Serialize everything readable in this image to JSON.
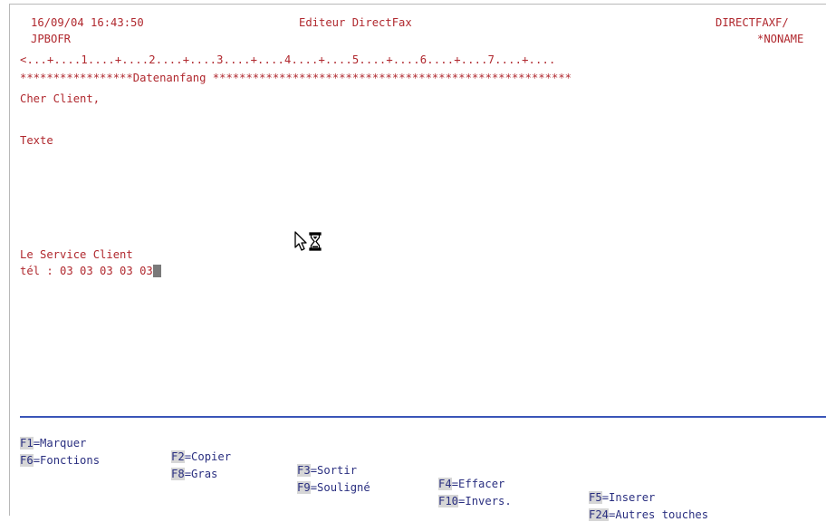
{
  "header": {
    "datetime": "16/09/04 16:43:50",
    "title": "Editeur DirectFax",
    "right_program": "DIRECTFAXF/",
    "user": "JPBOFR",
    "right_doc": "*NONAME"
  },
  "editor": {
    "ruler": "<...+....1....+....2....+....3....+....4....+....5....+....6....+....7....+....",
    "data_start_marker": "*****************Datenanfang ******************************************************",
    "lines": {
      "greeting": "Cher Client,",
      "body": "Texte",
      "signature": "Le Service Client",
      "phone": "tél : 03 03 03 03 03"
    }
  },
  "function_keys": {
    "row1": [
      {
        "key": "F1",
        "label": "Marquer"
      },
      {
        "key": "F2",
        "label": "Copier"
      },
      {
        "key": "F3",
        "label": "Sortir"
      },
      {
        "key": "F4",
        "label": "Effacer"
      },
      {
        "key": "F5",
        "label": "Inserer"
      }
    ],
    "row2": [
      {
        "key": "F6",
        "label": "Fonctions"
      },
      {
        "key": "F8",
        "label": "Gras"
      },
      {
        "key": "F9",
        "label": "Souligné"
      },
      {
        "key": "F10",
        "label": "Invers."
      },
      {
        "key": "F24",
        "label": "Autres touches"
      }
    ]
  },
  "colors": {
    "text": "#b0282e",
    "fkey_text": "#2a2f80",
    "separator": "#3a55b8"
  },
  "icons": {
    "mouse_pointer": "arrow-busy-hourglass-icon"
  }
}
